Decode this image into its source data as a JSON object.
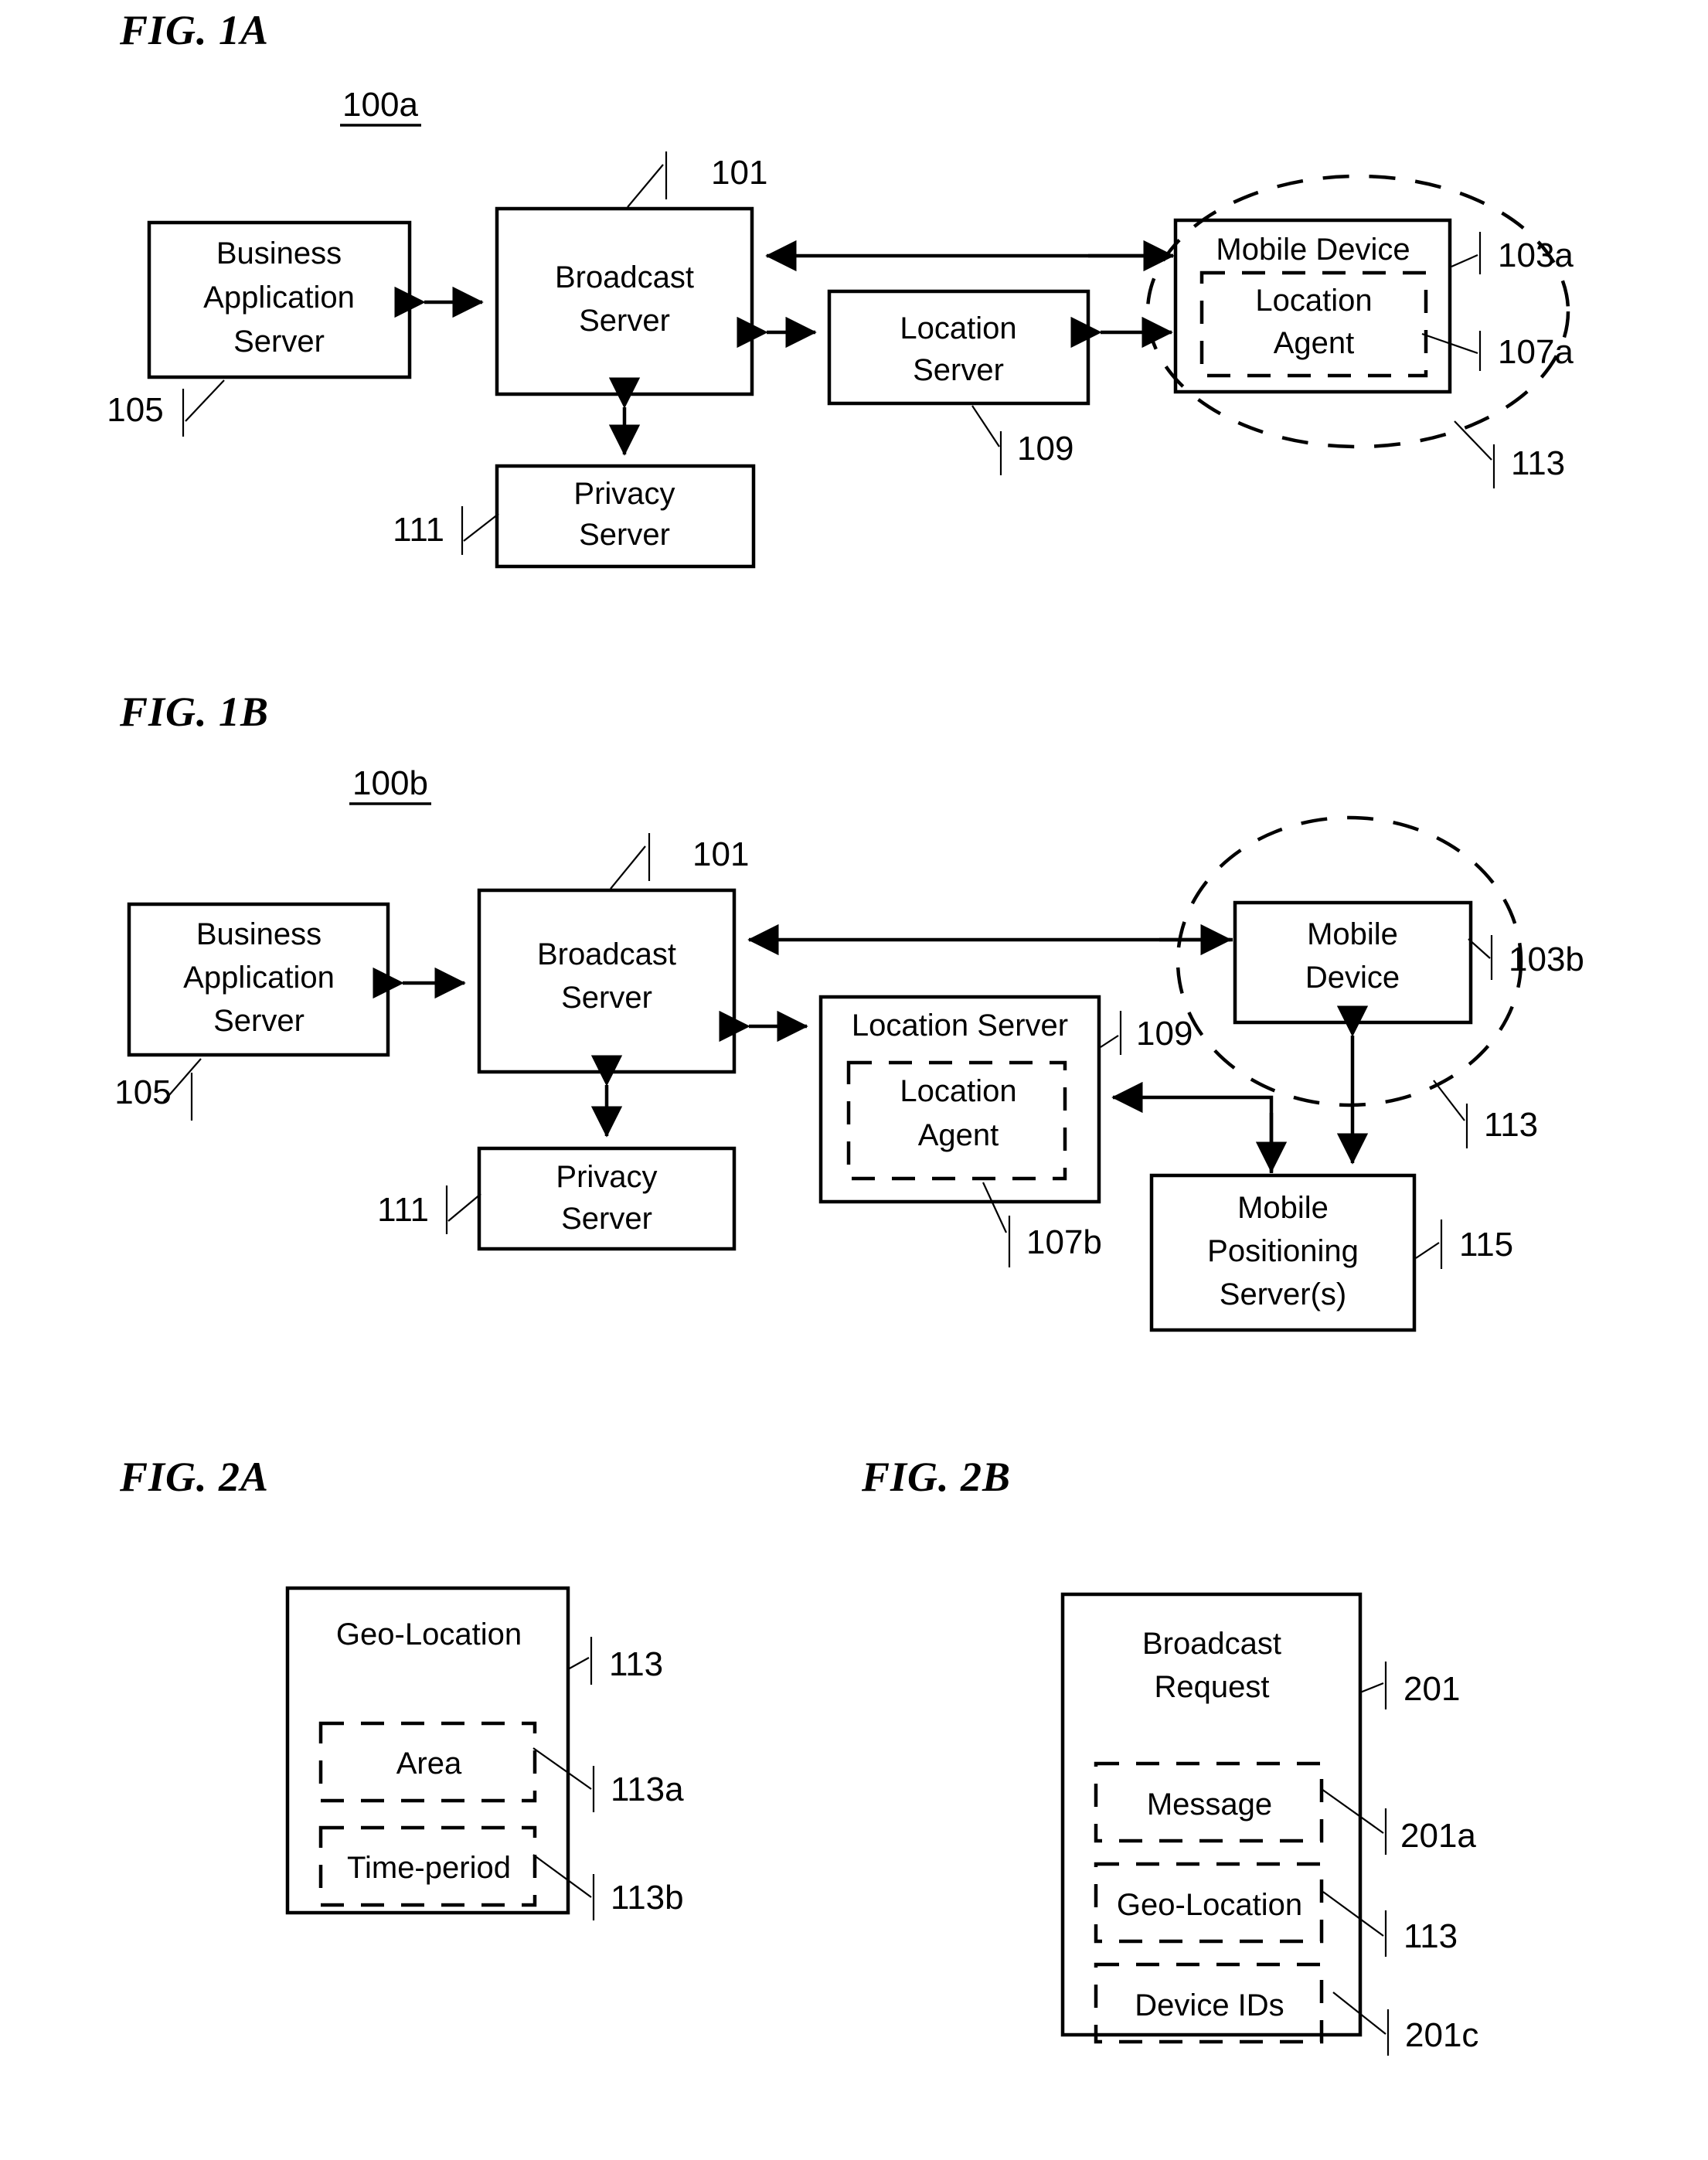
{
  "figures": [
    {
      "title": "FIG. 1A",
      "system_label": "100a",
      "blocks": [
        {
          "id": "business-application-server",
          "label": "Business Application Server",
          "lines": [
            "Business",
            "Application",
            "Server"
          ],
          "ref": "105"
        },
        {
          "id": "broadcast-server",
          "label": "Broadcast Server",
          "lines": [
            "Broadcast",
            "Server"
          ],
          "ref": "101"
        },
        {
          "id": "location-server",
          "label": "Location Server",
          "lines": [
            "Location",
            "Server"
          ],
          "ref": "109"
        },
        {
          "id": "privacy-server",
          "label": "Privacy Server",
          "lines": [
            "Privacy",
            "Server"
          ],
          "ref": "111"
        },
        {
          "id": "mobile-device",
          "label": "Mobile Device",
          "lines": [
            "Mobile Device"
          ],
          "ref": "103a"
        },
        {
          "id": "location-agent",
          "label": "Location Agent",
          "lines": [
            "Location",
            "Agent"
          ],
          "ref": "107a"
        },
        {
          "id": "geo-location-region",
          "label": "Geo-Location region",
          "lines": [],
          "ref": "113"
        }
      ]
    },
    {
      "title": "FIG. 1B",
      "system_label": "100b",
      "blocks": [
        {
          "id": "business-application-server",
          "label": "Business Application Server",
          "lines": [
            "Business",
            "Application",
            "Server"
          ],
          "ref": "105"
        },
        {
          "id": "broadcast-server",
          "label": "Broadcast Server",
          "lines": [
            "Broadcast",
            "Server"
          ],
          "ref": "101"
        },
        {
          "id": "location-server",
          "label": "Location Server",
          "lines": [
            "Location Server"
          ],
          "ref": "109"
        },
        {
          "id": "location-agent",
          "label": "Location Agent",
          "lines": [
            "Location",
            "Agent"
          ],
          "ref": "107b"
        },
        {
          "id": "privacy-server",
          "label": "Privacy Server",
          "lines": [
            "Privacy",
            "Server"
          ],
          "ref": "111"
        },
        {
          "id": "mobile-device",
          "label": "Mobile Device",
          "lines": [
            "Mobile",
            "Device"
          ],
          "ref": "103b"
        },
        {
          "id": "mobile-positioning-servers",
          "label": "Mobile Positioning Server(s)",
          "lines": [
            "Mobile",
            "Positioning",
            "Server(s)"
          ],
          "ref": "115"
        },
        {
          "id": "geo-location-region",
          "label": "Geo-Location region",
          "lines": [],
          "ref": "113"
        }
      ]
    },
    {
      "title": "FIG. 2A",
      "system_label": "",
      "blocks": [
        {
          "id": "geo-location",
          "label": "Geo-Location",
          "lines": [
            "Geo-Location"
          ],
          "ref": "113"
        },
        {
          "id": "area",
          "label": "Area",
          "lines": [
            "Area"
          ],
          "ref": "113a"
        },
        {
          "id": "time-period",
          "label": "Time-period",
          "lines": [
            "Time-period"
          ],
          "ref": "113b"
        }
      ]
    },
    {
      "title": "FIG. 2B",
      "system_label": "",
      "blocks": [
        {
          "id": "broadcast-request",
          "label": "Broadcast Request",
          "lines": [
            "Broadcast",
            "Request"
          ],
          "ref": "201"
        },
        {
          "id": "message",
          "label": "Message",
          "lines": [
            "Message"
          ],
          "ref": "201a"
        },
        {
          "id": "geo-location",
          "label": "Geo-Location",
          "lines": [
            "Geo-Location"
          ],
          "ref": "113"
        },
        {
          "id": "device-ids",
          "label": "Device IDs",
          "lines": [
            "Device IDs"
          ],
          "ref": "201c"
        }
      ]
    }
  ],
  "fig1a": {
    "title": "FIG. 1A",
    "system_label": "100a",
    "business_application_server": {
      "l1": "Business",
      "l2": "Application",
      "l3": "Server",
      "ref": "105"
    },
    "broadcast_server": {
      "l1": "Broadcast",
      "l2": "Server",
      "ref": "101"
    },
    "location_server": {
      "l1": "Location",
      "l2": "Server",
      "ref": "109"
    },
    "privacy_server": {
      "l1": "Privacy",
      "l2": "Server",
      "ref": "111"
    },
    "mobile_device": {
      "l1": "Mobile Device",
      "ref": "103a"
    },
    "location_agent": {
      "l1": "Location",
      "l2": "Agent",
      "ref": "107a"
    },
    "region_ref": "113"
  },
  "fig1b": {
    "title": "FIG. 1B",
    "system_label": "100b",
    "business_application_server": {
      "l1": "Business",
      "l2": "Application",
      "l3": "Server",
      "ref": "105"
    },
    "broadcast_server": {
      "l1": "Broadcast",
      "l2": "Server",
      "ref": "101"
    },
    "location_server": {
      "l1": "Location Server",
      "ref": "109"
    },
    "location_agent": {
      "l1": "Location",
      "l2": "Agent",
      "ref": "107b"
    },
    "privacy_server": {
      "l1": "Privacy",
      "l2": "Server",
      "ref": "111"
    },
    "mobile_device": {
      "l1": "Mobile",
      "l2": "Device",
      "ref": "103b"
    },
    "mobile_positioning_server": {
      "l1": "Mobile",
      "l2": "Positioning",
      "l3": "Server(s)",
      "ref": "115"
    },
    "region_ref": "113"
  },
  "fig2a": {
    "title": "FIG. 2A",
    "geo_location": {
      "l1": "Geo-Location",
      "ref": "113"
    },
    "area": {
      "l1": "Area",
      "ref": "113a"
    },
    "time_period": {
      "l1": "Time-period",
      "ref": "113b"
    }
  },
  "fig2b": {
    "title": "FIG. 2B",
    "broadcast_request": {
      "l1": "Broadcast",
      "l2": "Request",
      "ref": "201"
    },
    "message": {
      "l1": "Message",
      "ref": "201a"
    },
    "geo_location": {
      "l1": "Geo-Location",
      "ref": "113"
    },
    "device_ids": {
      "l1": "Device IDs",
      "ref": "201c"
    }
  },
  "colors": {
    "ink": "#000000",
    "paper": "#ffffff"
  }
}
